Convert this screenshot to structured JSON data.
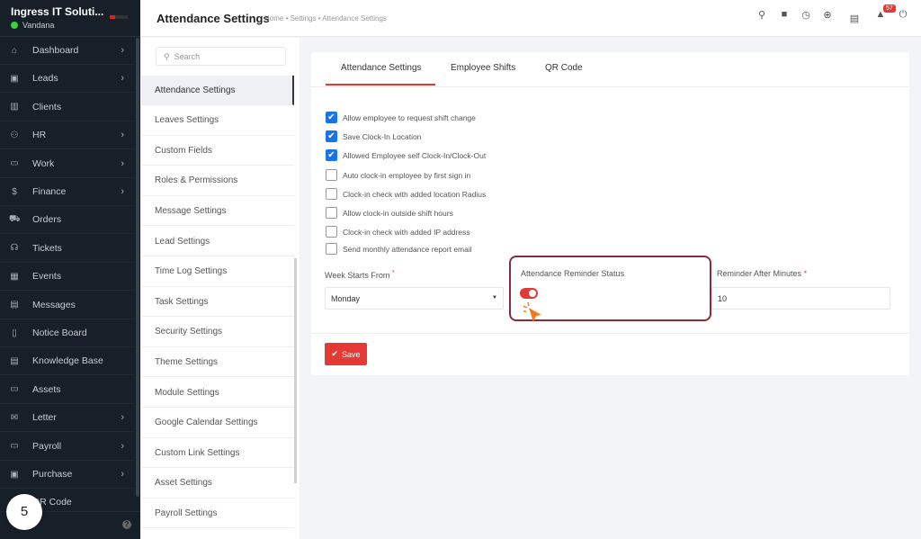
{
  "sidebar": {
    "company": "Ingress IT Soluti...",
    "user": "Vandana",
    "items": [
      {
        "label": "Dashboard",
        "icon": "home-icon",
        "glyph": "⌂",
        "chev": true
      },
      {
        "label": "Leads",
        "icon": "contact-card-icon",
        "glyph": "▣",
        "chev": true
      },
      {
        "label": "Clients",
        "icon": "building-icon",
        "glyph": "▥",
        "chev": false
      },
      {
        "label": "HR",
        "icon": "users-icon",
        "glyph": "⚇",
        "chev": true
      },
      {
        "label": "Work",
        "icon": "briefcase-icon",
        "glyph": "▭",
        "chev": true
      },
      {
        "label": "Finance",
        "icon": "dollar-icon",
        "glyph": "$",
        "chev": true
      },
      {
        "label": "Orders",
        "icon": "cart-icon",
        "glyph": "⛟",
        "chev": false
      },
      {
        "label": "Tickets",
        "icon": "headset-icon",
        "glyph": "☊",
        "chev": false
      },
      {
        "label": "Events",
        "icon": "calendar-icon",
        "glyph": "▦",
        "chev": false
      },
      {
        "label": "Messages",
        "icon": "chat-icon",
        "glyph": "▤",
        "chev": false
      },
      {
        "label": "Notice Board",
        "icon": "clipboard-icon",
        "glyph": "▯",
        "chev": false
      },
      {
        "label": "Knowledge Base",
        "icon": "book-icon",
        "glyph": "▤",
        "chev": false
      },
      {
        "label": "Assets",
        "icon": "monitor-icon",
        "glyph": "▭",
        "chev": false
      },
      {
        "label": "Letter",
        "icon": "envelope-icon",
        "glyph": "✉",
        "chev": true
      },
      {
        "label": "Payroll",
        "icon": "wallet-icon",
        "glyph": "▭",
        "chev": true
      },
      {
        "label": "Purchase",
        "icon": "receipt-icon",
        "glyph": "▣",
        "chev": true
      },
      {
        "label": "QR Code",
        "icon": "qr-icon",
        "glyph": "▦",
        "chev": false
      }
    ],
    "help": "?"
  },
  "step_marker": "5",
  "header": {
    "title": "Attendance Settings",
    "breadcrumb": "Home • Settings • Attendance Settings",
    "notification_count": "57"
  },
  "settings_menu": {
    "search_placeholder": "Search",
    "items": [
      "Attendance Settings",
      "Leaves Settings",
      "Custom Fields",
      "Roles & Permissions",
      "Message Settings",
      "Lead Settings",
      "Time Log Settings",
      "Task Settings",
      "Security Settings",
      "Theme Settings",
      "Module Settings",
      "Google Calendar Settings",
      "Custom Link Settings",
      "Asset Settings",
      "Payroll Settings"
    ],
    "active": 0
  },
  "tabs": [
    "Attendance Settings",
    "Employee Shifts",
    "QR Code"
  ],
  "checkboxes": [
    {
      "label": "Allow employee to request shift change",
      "checked": true
    },
    {
      "label": "Save Clock-In Location",
      "checked": true
    },
    {
      "label": "Allowed Employee self Clock-In/Clock-Out",
      "checked": true
    },
    {
      "label": "Auto clock-in employee by first sign in",
      "checked": false
    },
    {
      "label": "Clock-in check with added location Radius",
      "checked": false
    },
    {
      "label": "Allow clock-in outside shift hours",
      "checked": false
    },
    {
      "label": "Clock-in check with added IP address",
      "checked": false
    },
    {
      "label": "Send monthly attendance report email",
      "checked": false
    }
  ],
  "form": {
    "week_label": "Week Starts From",
    "week_value": "Monday",
    "reminder_status_label": "Attendance Reminder Status",
    "reminder_status_on": true,
    "minutes_label": "Reminder After Minutes",
    "minutes_value": "10",
    "required_mark": "*"
  },
  "save_label": "Save",
  "colors": {
    "accent": "#e53935",
    "checkbox": "#1a73e8",
    "sidebar": "#171f29",
    "highlight": "#8a2d3b"
  }
}
